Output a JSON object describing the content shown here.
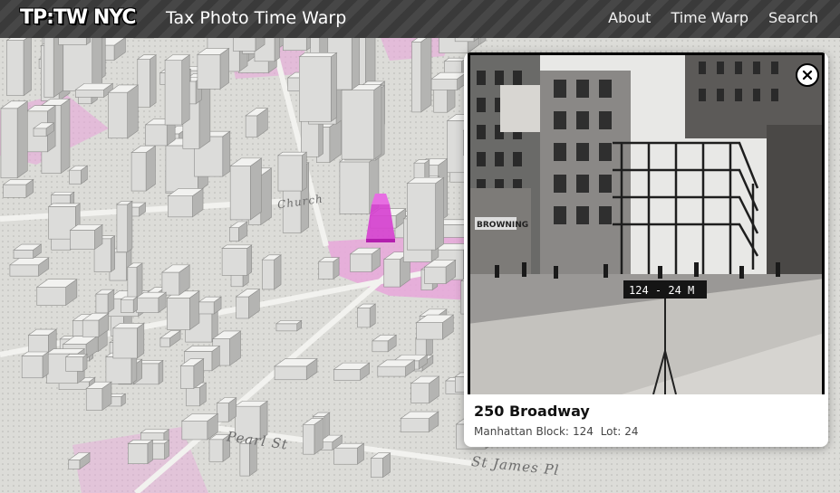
{
  "header": {
    "logo_text": "TP:TW NYC",
    "site_title": "Tax Photo Time Warp",
    "nav": [
      "About",
      "Time Warp",
      "Search"
    ]
  },
  "map": {
    "street_labels": [
      "Church",
      "Pearl St",
      "St James Pl"
    ],
    "highlight_color": "#e59ad6",
    "selected_building_color": "#d63fd0"
  },
  "photo_card": {
    "address": "250 Broadway",
    "borough_block_label": "Manhattan Block:",
    "block": "124",
    "lot_label": "Lot:",
    "lot": "24",
    "photo_sign_text": "124 - 24  M",
    "photo_storefront_text": "BROWNING",
    "close_icon": "close-icon"
  }
}
